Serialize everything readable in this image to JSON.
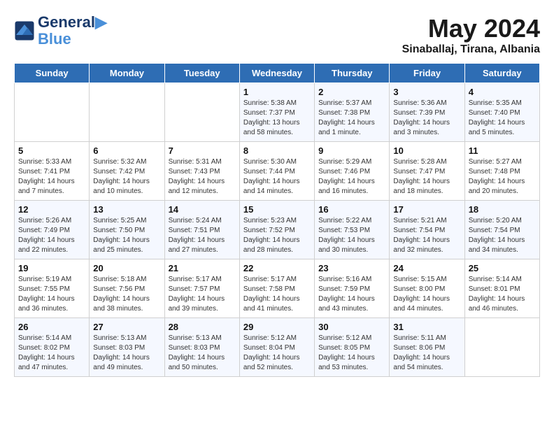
{
  "logo": {
    "line1": "General",
    "line2": "Blue"
  },
  "title": "May 2024",
  "location": "Sinaballaj, Tirana, Albania",
  "days_of_week": [
    "Sunday",
    "Monday",
    "Tuesday",
    "Wednesday",
    "Thursday",
    "Friday",
    "Saturday"
  ],
  "weeks": [
    [
      {
        "day": "",
        "sunrise": "",
        "sunset": "",
        "daylight": ""
      },
      {
        "day": "",
        "sunrise": "",
        "sunset": "",
        "daylight": ""
      },
      {
        "day": "",
        "sunrise": "",
        "sunset": "",
        "daylight": ""
      },
      {
        "day": "1",
        "sunrise": "Sunrise: 5:38 AM",
        "sunset": "Sunset: 7:37 PM",
        "daylight": "Daylight: 13 hours and 58 minutes."
      },
      {
        "day": "2",
        "sunrise": "Sunrise: 5:37 AM",
        "sunset": "Sunset: 7:38 PM",
        "daylight": "Daylight: 14 hours and 1 minute."
      },
      {
        "day": "3",
        "sunrise": "Sunrise: 5:36 AM",
        "sunset": "Sunset: 7:39 PM",
        "daylight": "Daylight: 14 hours and 3 minutes."
      },
      {
        "day": "4",
        "sunrise": "Sunrise: 5:35 AM",
        "sunset": "Sunset: 7:40 PM",
        "daylight": "Daylight: 14 hours and 5 minutes."
      }
    ],
    [
      {
        "day": "5",
        "sunrise": "Sunrise: 5:33 AM",
        "sunset": "Sunset: 7:41 PM",
        "daylight": "Daylight: 14 hours and 7 minutes."
      },
      {
        "day": "6",
        "sunrise": "Sunrise: 5:32 AM",
        "sunset": "Sunset: 7:42 PM",
        "daylight": "Daylight: 14 hours and 10 minutes."
      },
      {
        "day": "7",
        "sunrise": "Sunrise: 5:31 AM",
        "sunset": "Sunset: 7:43 PM",
        "daylight": "Daylight: 14 hours and 12 minutes."
      },
      {
        "day": "8",
        "sunrise": "Sunrise: 5:30 AM",
        "sunset": "Sunset: 7:44 PM",
        "daylight": "Daylight: 14 hours and 14 minutes."
      },
      {
        "day": "9",
        "sunrise": "Sunrise: 5:29 AM",
        "sunset": "Sunset: 7:46 PM",
        "daylight": "Daylight: 14 hours and 16 minutes."
      },
      {
        "day": "10",
        "sunrise": "Sunrise: 5:28 AM",
        "sunset": "Sunset: 7:47 PM",
        "daylight": "Daylight: 14 hours and 18 minutes."
      },
      {
        "day": "11",
        "sunrise": "Sunrise: 5:27 AM",
        "sunset": "Sunset: 7:48 PM",
        "daylight": "Daylight: 14 hours and 20 minutes."
      }
    ],
    [
      {
        "day": "12",
        "sunrise": "Sunrise: 5:26 AM",
        "sunset": "Sunset: 7:49 PM",
        "daylight": "Daylight: 14 hours and 22 minutes."
      },
      {
        "day": "13",
        "sunrise": "Sunrise: 5:25 AM",
        "sunset": "Sunset: 7:50 PM",
        "daylight": "Daylight: 14 hours and 25 minutes."
      },
      {
        "day": "14",
        "sunrise": "Sunrise: 5:24 AM",
        "sunset": "Sunset: 7:51 PM",
        "daylight": "Daylight: 14 hours and 27 minutes."
      },
      {
        "day": "15",
        "sunrise": "Sunrise: 5:23 AM",
        "sunset": "Sunset: 7:52 PM",
        "daylight": "Daylight: 14 hours and 28 minutes."
      },
      {
        "day": "16",
        "sunrise": "Sunrise: 5:22 AM",
        "sunset": "Sunset: 7:53 PM",
        "daylight": "Daylight: 14 hours and 30 minutes."
      },
      {
        "day": "17",
        "sunrise": "Sunrise: 5:21 AM",
        "sunset": "Sunset: 7:54 PM",
        "daylight": "Daylight: 14 hours and 32 minutes."
      },
      {
        "day": "18",
        "sunrise": "Sunrise: 5:20 AM",
        "sunset": "Sunset: 7:54 PM",
        "daylight": "Daylight: 14 hours and 34 minutes."
      }
    ],
    [
      {
        "day": "19",
        "sunrise": "Sunrise: 5:19 AM",
        "sunset": "Sunset: 7:55 PM",
        "daylight": "Daylight: 14 hours and 36 minutes."
      },
      {
        "day": "20",
        "sunrise": "Sunrise: 5:18 AM",
        "sunset": "Sunset: 7:56 PM",
        "daylight": "Daylight: 14 hours and 38 minutes."
      },
      {
        "day": "21",
        "sunrise": "Sunrise: 5:17 AM",
        "sunset": "Sunset: 7:57 PM",
        "daylight": "Daylight: 14 hours and 39 minutes."
      },
      {
        "day": "22",
        "sunrise": "Sunrise: 5:17 AM",
        "sunset": "Sunset: 7:58 PM",
        "daylight": "Daylight: 14 hours and 41 minutes."
      },
      {
        "day": "23",
        "sunrise": "Sunrise: 5:16 AM",
        "sunset": "Sunset: 7:59 PM",
        "daylight": "Daylight: 14 hours and 43 minutes."
      },
      {
        "day": "24",
        "sunrise": "Sunrise: 5:15 AM",
        "sunset": "Sunset: 8:00 PM",
        "daylight": "Daylight: 14 hours and 44 minutes."
      },
      {
        "day": "25",
        "sunrise": "Sunrise: 5:14 AM",
        "sunset": "Sunset: 8:01 PM",
        "daylight": "Daylight: 14 hours and 46 minutes."
      }
    ],
    [
      {
        "day": "26",
        "sunrise": "Sunrise: 5:14 AM",
        "sunset": "Sunset: 8:02 PM",
        "daylight": "Daylight: 14 hours and 47 minutes."
      },
      {
        "day": "27",
        "sunrise": "Sunrise: 5:13 AM",
        "sunset": "Sunset: 8:03 PM",
        "daylight": "Daylight: 14 hours and 49 minutes."
      },
      {
        "day": "28",
        "sunrise": "Sunrise: 5:13 AM",
        "sunset": "Sunset: 8:03 PM",
        "daylight": "Daylight: 14 hours and 50 minutes."
      },
      {
        "day": "29",
        "sunrise": "Sunrise: 5:12 AM",
        "sunset": "Sunset: 8:04 PM",
        "daylight": "Daylight: 14 hours and 52 minutes."
      },
      {
        "day": "30",
        "sunrise": "Sunrise: 5:12 AM",
        "sunset": "Sunset: 8:05 PM",
        "daylight": "Daylight: 14 hours and 53 minutes."
      },
      {
        "day": "31",
        "sunrise": "Sunrise: 5:11 AM",
        "sunset": "Sunset: 8:06 PM",
        "daylight": "Daylight: 14 hours and 54 minutes."
      },
      {
        "day": "",
        "sunrise": "",
        "sunset": "",
        "daylight": ""
      }
    ]
  ]
}
